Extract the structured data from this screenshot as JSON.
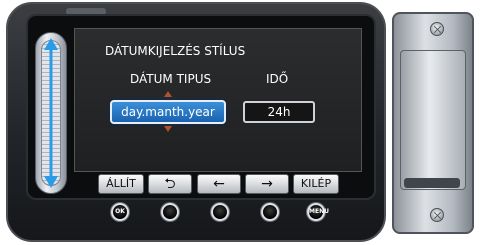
{
  "screen": {
    "title": "DÁTUMKIJELZÉS STÍLUS",
    "date_type_label": "DÁTUM TIPUS",
    "time_label": "IDŐ",
    "date_value": "day.manth.year",
    "time_value": "24h"
  },
  "softkeys": {
    "set": "ÁLLÍT",
    "back": "⮌",
    "left": "←",
    "right": "→",
    "exit": "KILÉP"
  },
  "buttons": {
    "ok": "OK",
    "menu": "MENU"
  },
  "colors": {
    "selected_field": "#1b63b0",
    "arrow_accent": "#b0522c"
  }
}
